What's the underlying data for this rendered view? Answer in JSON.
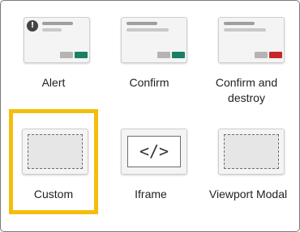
{
  "options": [
    {
      "label": "Alert",
      "icon": "alert-preview-icon",
      "info_glyph": "!",
      "primary_color": "#1a7f64",
      "secondary_color": "#b4b4b4"
    },
    {
      "label": "Confirm",
      "icon": "confirm-preview-icon",
      "primary_color": "#1a7f64",
      "secondary_color": "#b4b4b4"
    },
    {
      "label": "Confirm and destroy",
      "icon": "confirm-destroy-preview-icon",
      "primary_color": "#c62828",
      "secondary_color": "#b4b4b4"
    },
    {
      "label": "Custom",
      "icon": "custom-preview-icon",
      "selected": true
    },
    {
      "label": "Iframe",
      "icon": "iframe-preview-icon",
      "glyph": "</>"
    },
    {
      "label": "Viewport Modal",
      "icon": "viewport-modal-preview-icon"
    }
  ],
  "colors": {
    "selection": "#f4bd0c",
    "frame_border": "#7a7a7a"
  }
}
